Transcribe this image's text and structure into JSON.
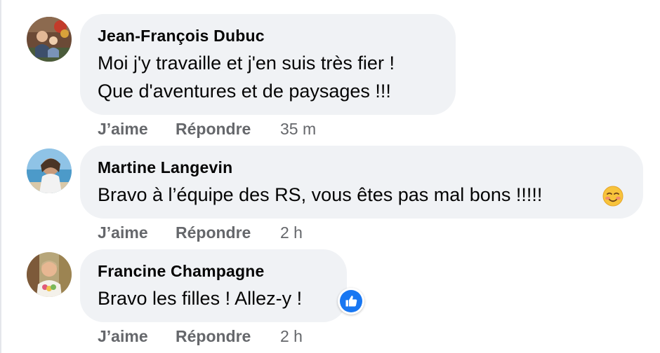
{
  "comments": [
    {
      "author": "Jean-François Dubuc",
      "lines": [
        "Moi j'y travaille et j'en suis très fier !",
        "Que d'aventures et de paysages !!!"
      ],
      "like_label": "J’aime",
      "reply_label": "Répondre",
      "time": "35 m"
    },
    {
      "author": "Martine Langevin",
      "lines": [
        "Bravo à l’équipe des RS, vous êtes pas mal bons !!!!!"
      ],
      "emoji": "smiling-face-icon",
      "like_label": "J’aime",
      "reply_label": "Répondre",
      "time": "2 h"
    },
    {
      "author": "Francine Champagne",
      "lines": [
        "Bravo les filles ! Allez-y !"
      ],
      "reaction": "like-icon",
      "like_label": "J’aime",
      "reply_label": "Répondre",
      "time": "2 h"
    }
  ],
  "colors": {
    "bubble": "#f0f2f5",
    "muted_text": "#65676b",
    "like_blue": "#1877f2"
  }
}
